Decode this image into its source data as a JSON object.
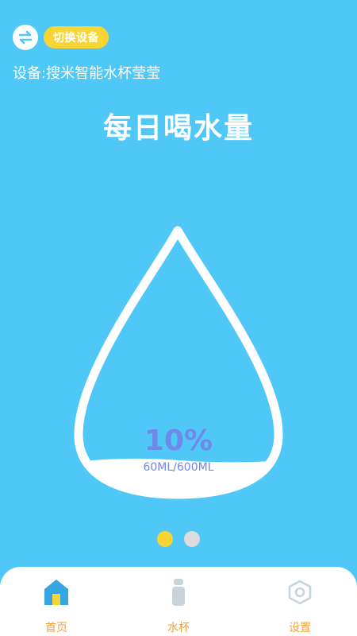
{
  "header": {
    "switch_label": "切换设备",
    "device_prefix": "设备:",
    "device_name": "搜米智能水杯莹莹"
  },
  "main": {
    "title": "每日喝水量",
    "percent": "10%",
    "volume": "60ML/600ML",
    "fill_fraction": 0.1
  },
  "pager": {
    "pages": 2,
    "active_index": 0
  },
  "tabbar": {
    "items": [
      {
        "label": "首页",
        "icon": "home-icon"
      },
      {
        "label": "水杯",
        "icon": "cup-icon"
      },
      {
        "label": "设置",
        "icon": "settings-hexagon-icon"
      }
    ]
  },
  "colors": {
    "background": "#4fc8f7",
    "accent_yellow": "#f7d534",
    "text_blue": "#6f88ea",
    "tab_label": "#f0a23c"
  }
}
